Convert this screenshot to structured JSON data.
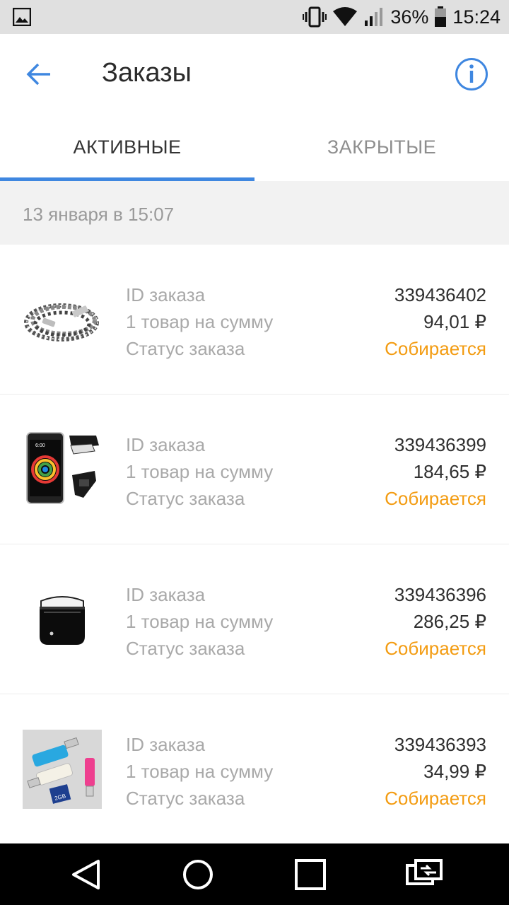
{
  "status_bar": {
    "battery": "36%",
    "time": "15:24",
    "icons": [
      "image-icon",
      "vibrate-icon",
      "wifi-icon",
      "signal-icon",
      "battery-icon"
    ]
  },
  "header": {
    "title": "Заказы",
    "back_icon": "arrow-left-icon",
    "info_icon": "info-icon"
  },
  "tabs": [
    {
      "label": "АКТИВНЫЕ",
      "active": true
    },
    {
      "label": "ЗАКРЫТЫЕ",
      "active": false
    }
  ],
  "date_header": "13 января в 15:07",
  "colors": {
    "accent": "#3f87e0",
    "status": "#f39c12",
    "label": "#a9a9a9"
  },
  "orders": [
    {
      "label_id": "ID заказа",
      "label_sum": "1 товар на сумму",
      "label_status": "Статус заказа",
      "id": "339436402",
      "sum": "94,01 ₽",
      "status": "Собирается",
      "product_icon": "usb-cable-image"
    },
    {
      "label_id": "ID заказа",
      "label_sum": "1 товар на сумму",
      "label_status": "Статус заказа",
      "id": "339436399",
      "sum": "184,65 ₽",
      "status": "Собирается",
      "product_icon": "phone-holster-image"
    },
    {
      "label_id": "ID заказа",
      "label_sum": "1 товар на сумму",
      "label_status": "Статус заказа",
      "id": "339436396",
      "sum": "286,25 ₽",
      "status": "Собирается",
      "product_icon": "earbuds-case-image"
    },
    {
      "label_id": "ID заказа",
      "label_sum": "1 товар на сумму",
      "label_status": "Статус заказа",
      "id": "339436393",
      "sum": "34,99 ₽",
      "status": "Собирается",
      "product_icon": "card-reader-image"
    }
  ],
  "nav_bar": {
    "icons": [
      "back-triangle-icon",
      "home-circle-icon",
      "recents-square-icon",
      "switch-apps-icon"
    ]
  }
}
